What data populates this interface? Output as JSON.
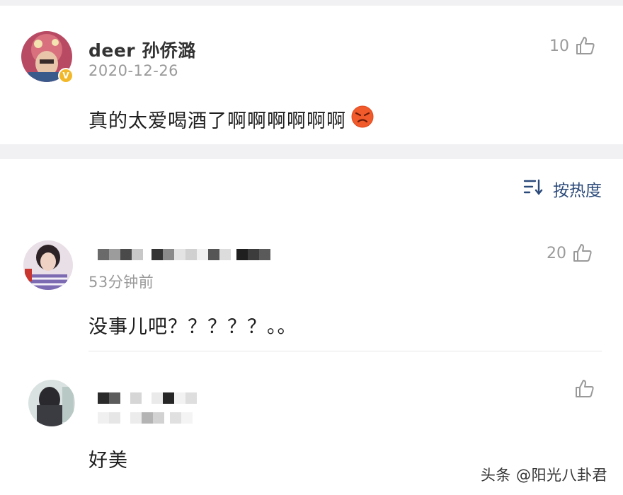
{
  "post": {
    "author_name": "deer 孙侨潞",
    "date": "2020-12-26",
    "text": "真的太爱喝酒了啊啊啊啊啊啊",
    "like_count": "10",
    "emoji": "angry-face-emoji",
    "verified": true
  },
  "sort": {
    "icon": "sort-icon",
    "label": "按热度"
  },
  "comments": [
    {
      "time": "53分钟前",
      "text": "没事儿吧？？？？？。。",
      "like_count": "20"
    },
    {
      "time": "",
      "text": "好美",
      "like_count": ""
    }
  ],
  "watermark": "头条 @阳光八卦君",
  "colors": {
    "background": "#f1f1f3",
    "card": "#ffffff",
    "accent": "#2b4a7a",
    "badge": "#f2b829",
    "meta": "#9a9a9a"
  }
}
